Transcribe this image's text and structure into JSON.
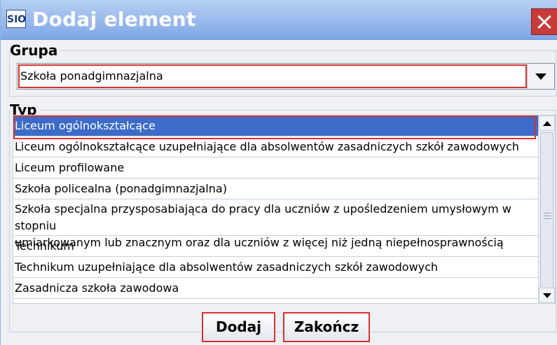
{
  "window": {
    "app_icon_text": "SIO",
    "title": "Dodaj element"
  },
  "grupa": {
    "legend": "Grupa",
    "selected_value": "Szkoła ponadgimnazjalna"
  },
  "typ": {
    "legend": "Typ",
    "items": [
      {
        "label": "Liceum ogólnokształcące",
        "selected": true
      },
      {
        "label": "Liceum ogólnokształcące uzupełniające dla absolwentów zasadniczych szkół zawodowych"
      },
      {
        "label": "Liceum profilowane"
      },
      {
        "label": "Szkoła policealna (ponadgimnazjalna)"
      },
      {
        "label_line1": "Szkoła specjalna przysposabiająca do pracy dla uczniów z upośledzeniem umysłowym w stopniu",
        "label_line2": "umiarkowanym lub znacznym oraz dla uczniów z  więcej niż jedną niepełnosprawnością"
      },
      {
        "label": "Technikum"
      },
      {
        "label": "Technikum uzupełniające dla absolwentów zasadniczych szkół zawodowych"
      },
      {
        "label": "Zasadnicza szkoła zawodowa"
      }
    ]
  },
  "buttons": {
    "add": "Dodaj",
    "finish": "Zakończ"
  }
}
